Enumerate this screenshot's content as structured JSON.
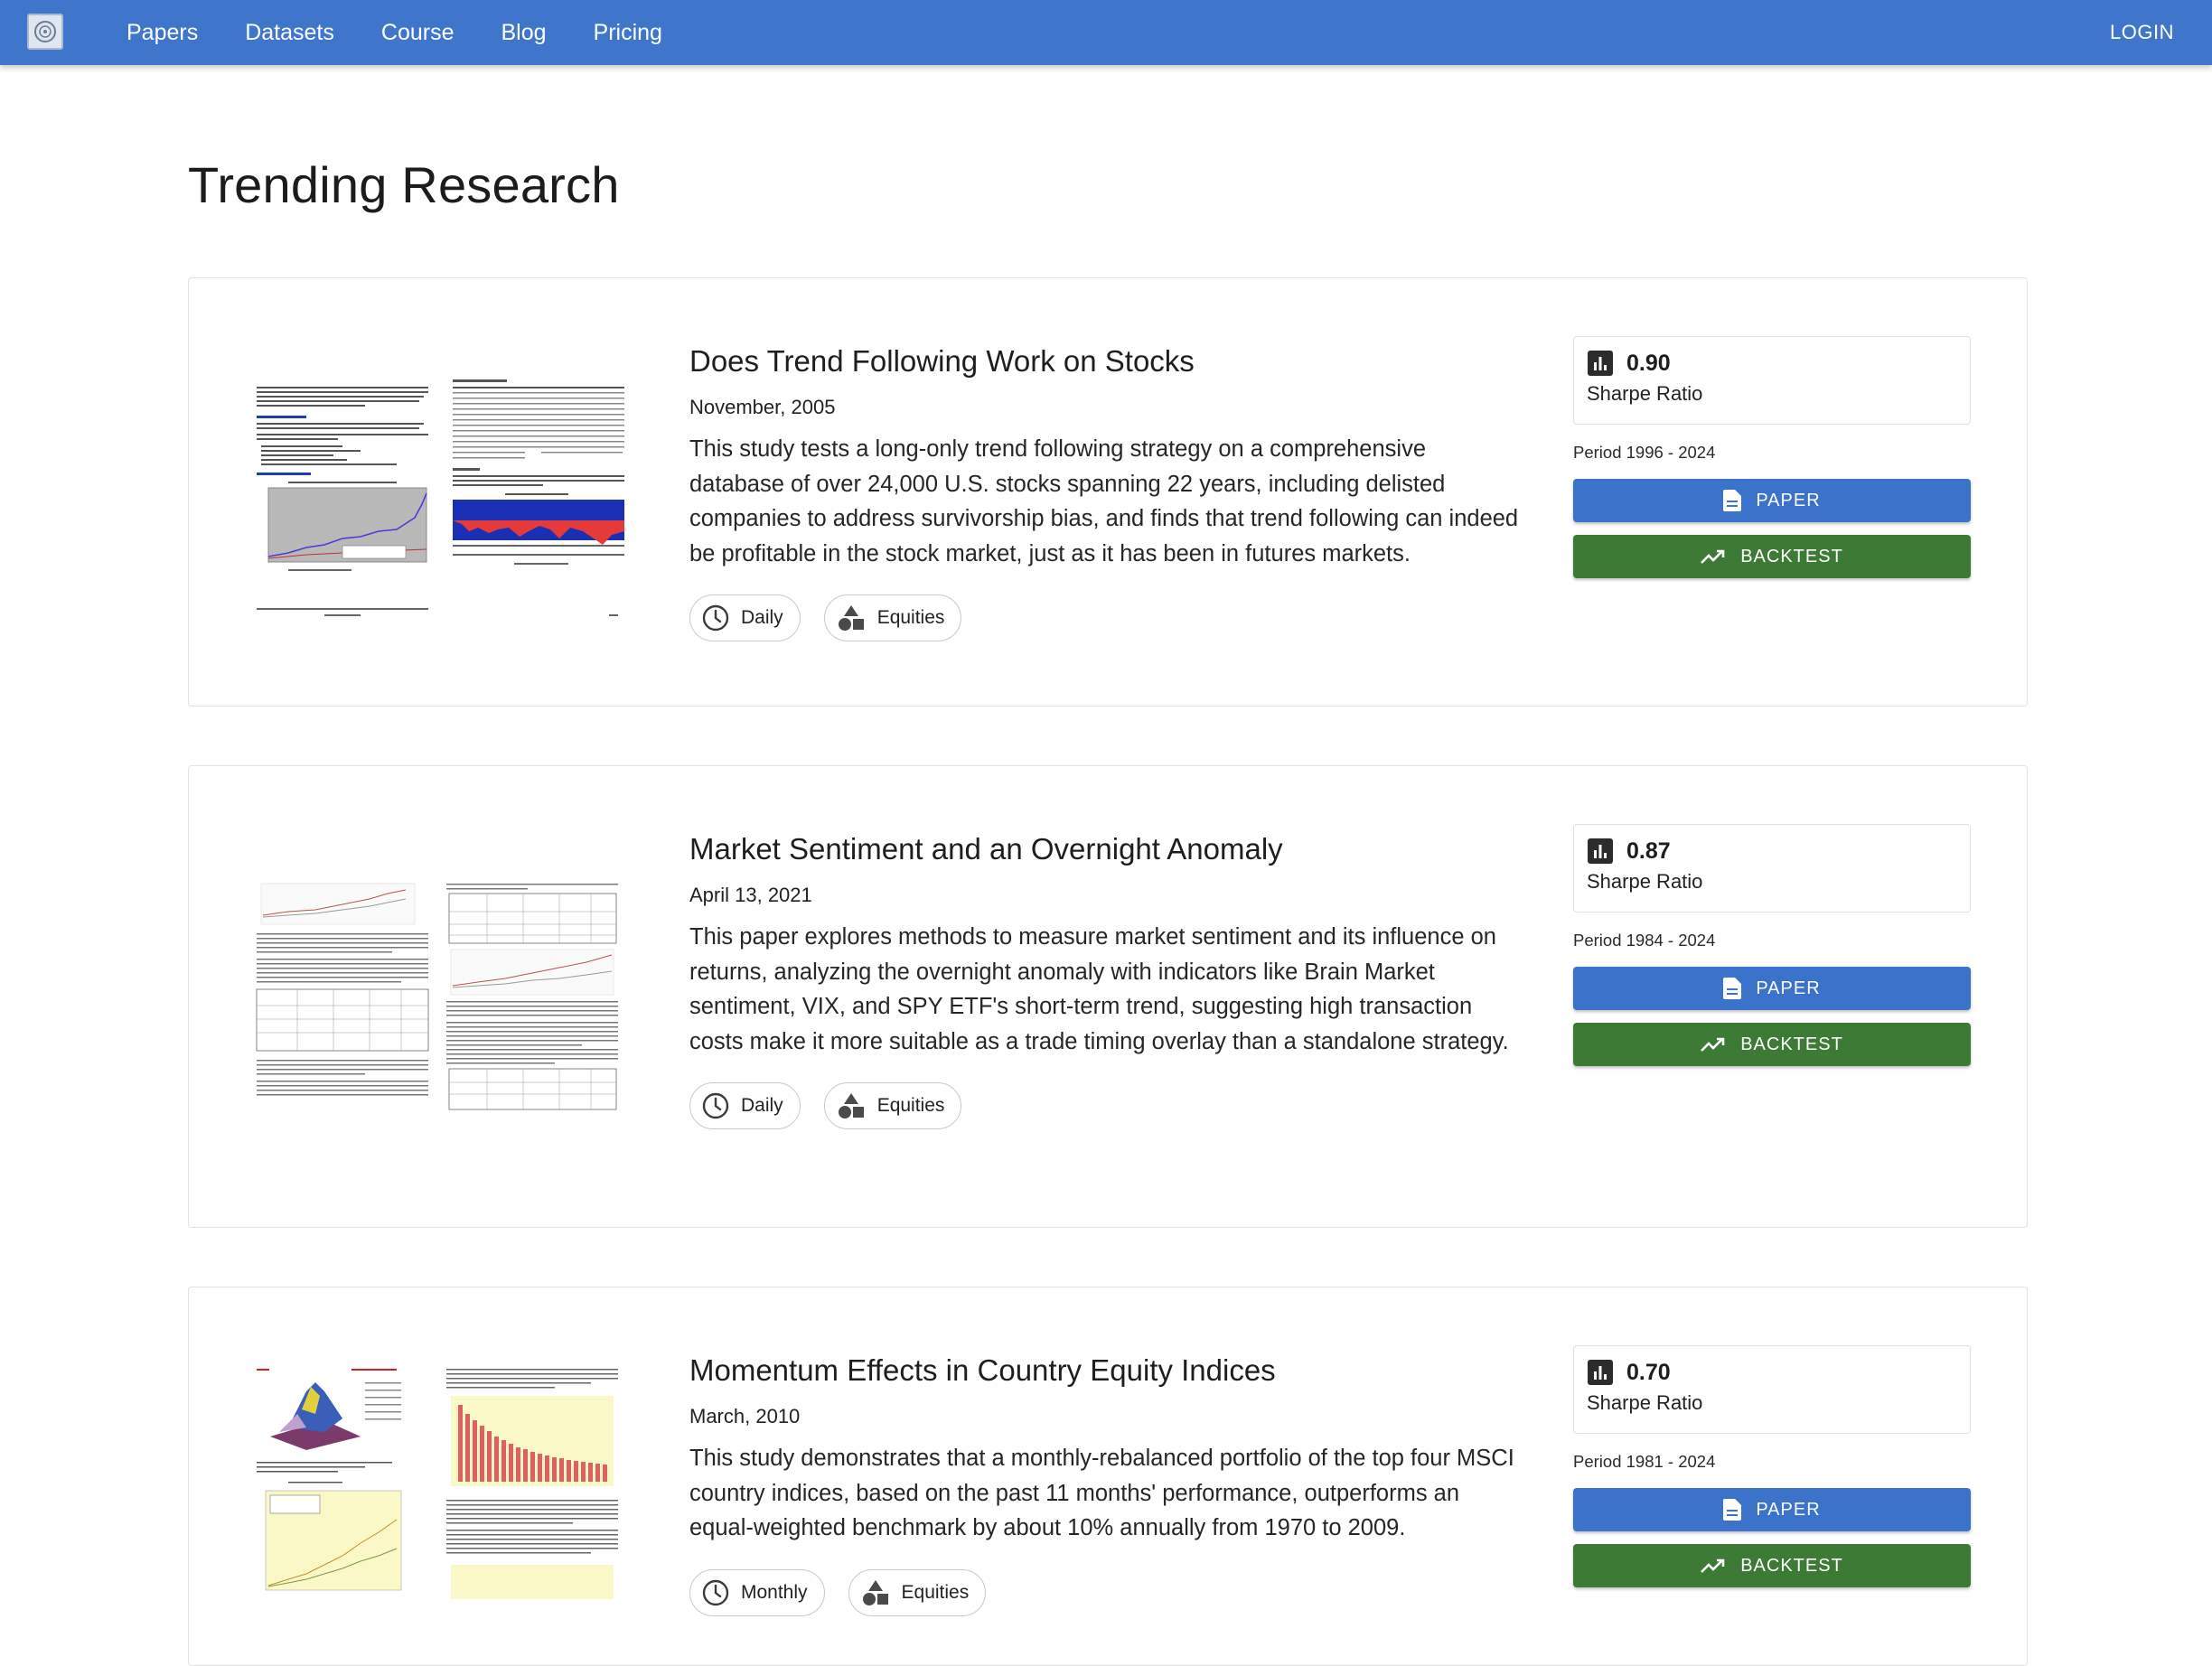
{
  "nav": {
    "links": [
      "Papers",
      "Datasets",
      "Course",
      "Blog",
      "Pricing"
    ],
    "login": "LOGIN"
  },
  "page": {
    "title": "Trending Research"
  },
  "cards": [
    {
      "title": "Does Trend Following Work on Stocks",
      "date": "November, 2005",
      "description": "This study tests a long-only trend following strategy on a comprehensive database of over 24,000 U.S. stocks spanning 22 years, including delisted companies to address survivorship bias, and finds that trend following can indeed be profitable in the stock market, just as it has been in futures markets.",
      "chips": [
        "Daily",
        "Equities"
      ],
      "sharpe_value": "0.90",
      "sharpe_label": "Sharpe Ratio",
      "period": "Period 1996 - 2024",
      "paper_label": "PAPER",
      "backtest_label": "BACKTEST"
    },
    {
      "title": "Market Sentiment and an Overnight Anomaly",
      "date": "April 13, 2021",
      "description": "This paper explores methods to measure market sentiment and its influence on returns, analyzing the overnight anomaly with indicators like Brain Market sentiment, VIX, and SPY ETF's short-term trend, suggesting high transaction costs make it more suitable as a trade timing overlay than a standalone strategy.",
      "chips": [
        "Daily",
        "Equities"
      ],
      "sharpe_value": "0.87",
      "sharpe_label": "Sharpe Ratio",
      "period": "Period 1984 - 2024",
      "paper_label": "PAPER",
      "backtest_label": "BACKTEST"
    },
    {
      "title": "Momentum Effects in Country Equity Indices",
      "date": "March, 2010",
      "description": "This study demonstrates that a monthly-rebalanced portfolio of the top four MSCI country indices, based on the past 11 months' performance, outperforms an equal-weighted benchmark by about 10% annually from 1970 to 2009.",
      "chips": [
        "Monthly",
        "Equities"
      ],
      "sharpe_value": "0.70",
      "sharpe_label": "Sharpe Ratio",
      "period": "Period 1981 - 2024",
      "paper_label": "PAPER",
      "backtest_label": "BACKTEST"
    }
  ],
  "colors": {
    "navbar": "#3f76cb",
    "paper_button": "#3b73cb",
    "backtest_button": "#3c7a35"
  },
  "icons": {
    "logo": "site-logo",
    "frequency_chip": "clock-icon",
    "asset_chip": "shapes-icon",
    "sharpe": "bar-chart-icon",
    "paper": "document-icon",
    "backtest": "trending-up-icon"
  }
}
